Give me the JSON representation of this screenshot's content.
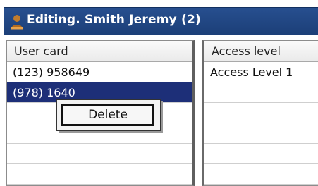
{
  "window": {
    "title": "Editing. Smith Jeremy (2)",
    "title_icon": "user-icon",
    "title_bar_color": "#274f8f"
  },
  "user_cards": {
    "header": "User card",
    "rows": [
      "(123) 958649",
      "(978) 1640",
      "",
      "",
      "",
      ""
    ]
  },
  "access_levels": {
    "header": "Access level",
    "rows": [
      "Access Level 1",
      "",
      "",
      "",
      "",
      ""
    ]
  },
  "context_menu": {
    "items": [
      {
        "label": "Delete"
      }
    ]
  },
  "colors": {
    "selection": "#1d2f78",
    "header_bg": "#f0f0f0"
  }
}
